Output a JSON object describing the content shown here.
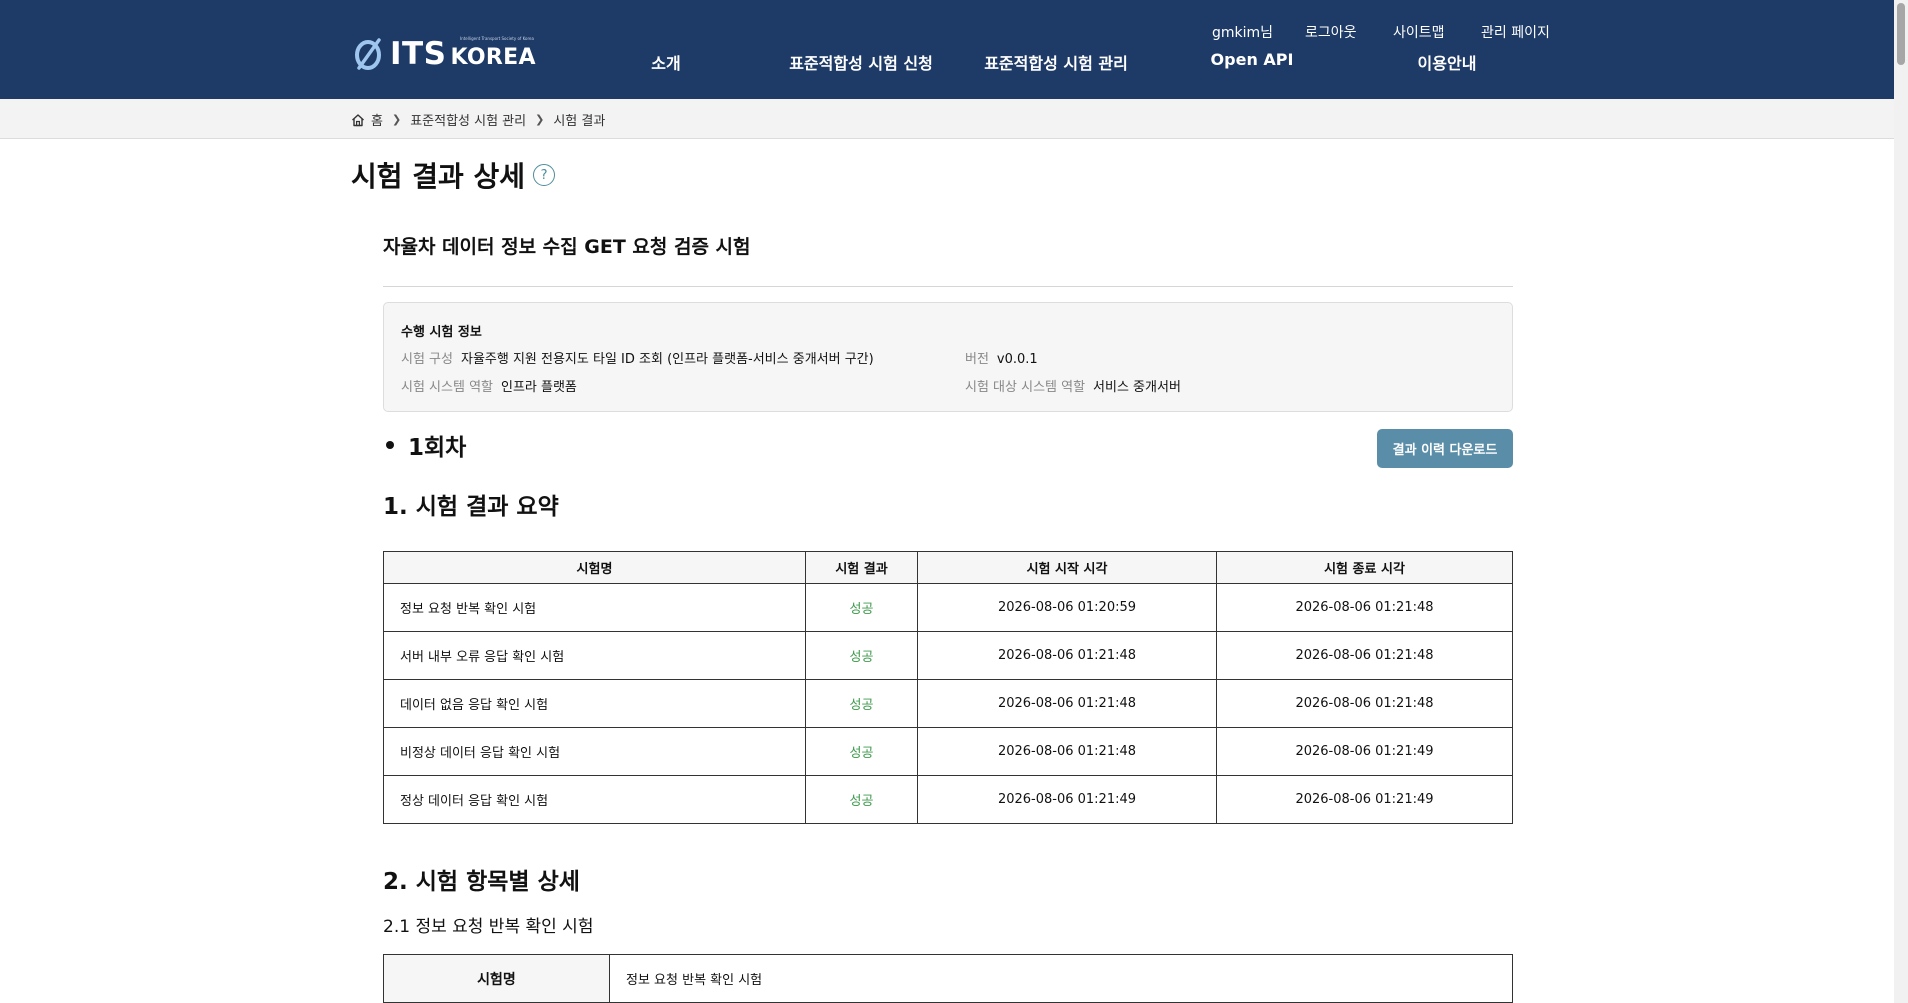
{
  "header": {
    "logo_text": "ITS",
    "logo_korea": "KOREA",
    "logo_tagline": "Intelligent Transport Society of Korea",
    "util_links": [
      "gmkim님",
      "로그아웃",
      "사이트맵",
      "관리 페이지"
    ],
    "nav": [
      "소개",
      "표준적합성 시험 신청",
      "표준적합성 시험 관리",
      "Open API",
      "이용안내"
    ]
  },
  "breadcrumb": [
    "홈",
    "표준적합성 시험 관리",
    "시험 결과"
  ],
  "page_title": "시험 결과 상세",
  "help_glyph": "?",
  "test_title": "자율차 데이터 정보 수집 GET 요청 검증 시험",
  "info": {
    "box_title": "수행 시험 정보",
    "config_label": "시험 구성",
    "config_value": "자율주행 지원 전용지도 타일 ID 조회 (인프라 플랫폼-서비스 중개서버 구간)",
    "version_label": "버전",
    "version_value": "v0.0.1",
    "role_label": "시험 시스템 역할",
    "role_value": "인프라 플랫폼",
    "target_label": "시험 대상 시스템 역할",
    "target_value": "서비스 중개서버"
  },
  "round_label": "1회차",
  "download_button": "결과 이력 다운로드",
  "section1_title": "1. 시험 결과 요약",
  "summary_table": {
    "headers": [
      "시험명",
      "시험 결과",
      "시험 시작 시각",
      "시험 종료 시각"
    ],
    "rows": [
      [
        "정보 요청 반복 확인 시험",
        "성공",
        "2026-08-06 01:20:59",
        "2026-08-06 01:21:48"
      ],
      [
        "서버 내부 오류 응답 확인 시험",
        "성공",
        "2026-08-06 01:21:48",
        "2026-08-06 01:21:48"
      ],
      [
        "데이터 없음 응답 확인 시험",
        "성공",
        "2026-08-06 01:21:48",
        "2026-08-06 01:21:48"
      ],
      [
        "비정상 데이터 응답 확인 시험",
        "성공",
        "2026-08-06 01:21:48",
        "2026-08-06 01:21:49"
      ],
      [
        "정상 데이터 응답 확인 시험",
        "성공",
        "2026-08-06 01:21:49",
        "2026-08-06 01:21:49"
      ]
    ]
  },
  "section2_title": "2. 시험 항목별 상세",
  "subsection_title": "2.1 정보 요청 반복 확인 시험",
  "detail_table": {
    "label": "시험명",
    "value": "정보 요청 반복 확인 시험"
  },
  "colors": {
    "header_bg": "#1e3a66",
    "success": "#3f9a4c",
    "button_bg": "#5a8ea8"
  }
}
